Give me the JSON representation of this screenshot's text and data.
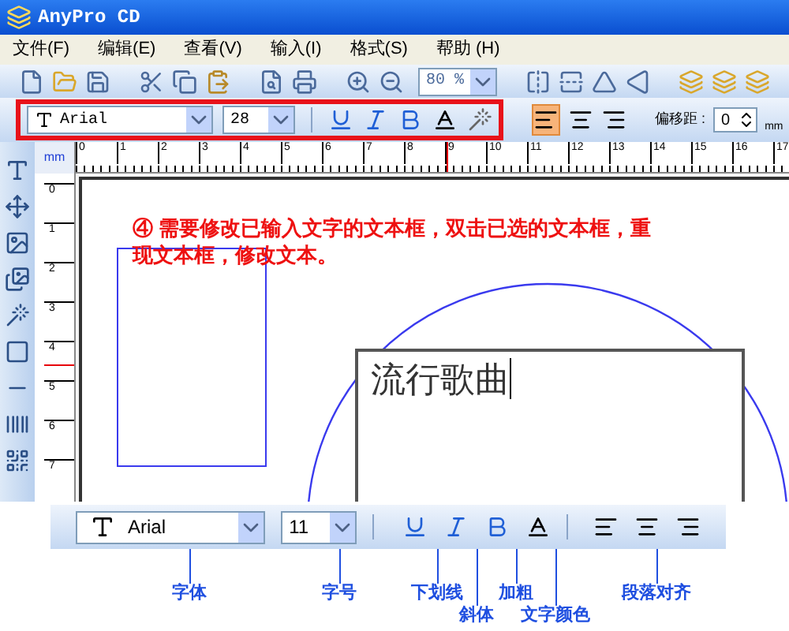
{
  "window": {
    "title": "AnyPro CD"
  },
  "menu": [
    {
      "label": "文件(F)"
    },
    {
      "label": "编辑(E)"
    },
    {
      "label": "查看(V)"
    },
    {
      "label": "输入(I)"
    },
    {
      "label": "格式(S)"
    },
    {
      "label": "帮助 (H)"
    }
  ],
  "toolbar": {
    "zoom": "80 %"
  },
  "format_toolbar": {
    "font": "Arial",
    "size": "28",
    "align": [
      {
        "selected": true
      },
      {
        "selected": false
      },
      {
        "selected": false
      }
    ],
    "spacing_label": "偏移距 :",
    "spacing": "0",
    "unit": "mm"
  },
  "ruler": {
    "unit": "mm",
    "h_ticks": [
      "0",
      "1",
      "2",
      "3",
      "4",
      "5",
      "6",
      "7",
      "8",
      "9",
      "10",
      "11",
      "12",
      "13",
      "14",
      "15",
      "16",
      "17"
    ],
    "v_ticks": [
      "0",
      "1",
      "2",
      "3",
      "4",
      "5",
      "6",
      "7"
    ]
  },
  "canvas": {
    "instruction": "④ 需要修改已输入文字的文本框，双击已选的文本框，重现文本框，修改文本。",
    "text_box": "流行歌曲"
  },
  "callout": {
    "font": "Arial",
    "size": "11",
    "labels": [
      {
        "text": "字体"
      },
      {
        "text": "字号"
      },
      {
        "text": "下划线"
      },
      {
        "text": "斜体"
      },
      {
        "text": "加粗"
      },
      {
        "text": "文字颜色"
      },
      {
        "text": "段落对齐"
      }
    ]
  }
}
